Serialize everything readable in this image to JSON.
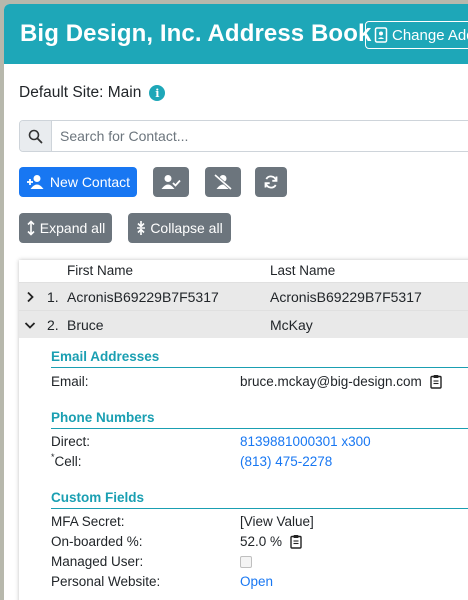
{
  "header": {
    "title": "Big Design, Inc. Address Book",
    "change_button_label": "Change Address"
  },
  "site": {
    "label": "Default Site: Main"
  },
  "search": {
    "placeholder": "Search for Contact...",
    "value": ""
  },
  "toolbar": {
    "new_contact_label": "New Contact",
    "expand_all_label": "Expand all",
    "collapse_all_label": "Collapse all"
  },
  "table": {
    "columns": [
      "First Name",
      "Last Name"
    ],
    "rows": [
      {
        "index": "1.",
        "first": "AcronisB69229B7F5317",
        "last": "AcronisB69229B7F5317",
        "expanded": false
      },
      {
        "index": "2.",
        "first": "Bruce",
        "last": "McKay",
        "expanded": true
      }
    ]
  },
  "detail": {
    "email_section": {
      "title": "Email Addresses",
      "label": "Email:",
      "value": "bruce.mckay@big-design.com"
    },
    "phone_section": {
      "title": "Phone Numbers",
      "direct_label": "Direct:",
      "direct_value": "8139881000301 x300",
      "cell_marker": "*",
      "cell_label": "Cell:",
      "cell_value": "(813) 475-2278"
    },
    "custom_section": {
      "title": "Custom Fields",
      "mfa_label": "MFA Secret:",
      "mfa_value": "[View Value]",
      "onboarded_label": "On-boarded %:",
      "onboarded_value": "52.0 %",
      "managed_label": "Managed User:",
      "managed_checked": false,
      "website_label": "Personal Website:",
      "website_value": "Open"
    }
  },
  "colors": {
    "header_bg": "#1ea7b8",
    "primary": "#1877f2",
    "secondary": "#6c757d",
    "section_title": "#1a9fb2"
  }
}
